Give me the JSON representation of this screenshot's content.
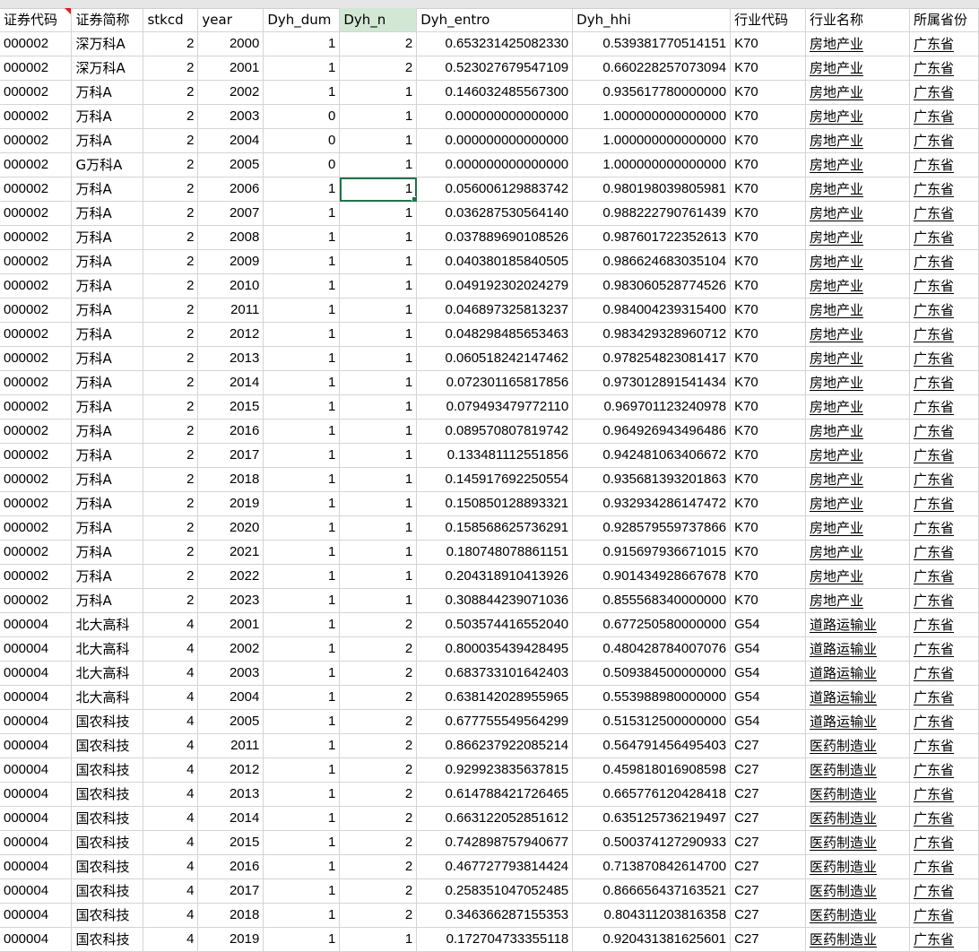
{
  "columns": [
    "证券代码",
    "证券简称",
    "stkcd",
    "year",
    "Dyh_dum",
    "Dyh_n",
    "Dyh_entro",
    "Dyh_hhi",
    "行业代码",
    "行业名称",
    "所属省份"
  ],
  "header_display": [
    "证券代码",
    "证券简称",
    "stkcd",
    "year",
    "Dyh_dum",
    "Dyh_n",
    "Dyh_entro",
    "Dyh_hhi",
    "行业代码",
    "行业名称",
    "所属省份"
  ],
  "rows": [
    [
      "000002",
      "深万科A",
      "2",
      "2000",
      "1",
      "2",
      "0.653231425082330",
      "0.539381770514151",
      "K70",
      "房地产业",
      "广东省"
    ],
    [
      "000002",
      "深万科A",
      "2",
      "2001",
      "1",
      "2",
      "0.523027679547109",
      "0.660228257073094",
      "K70",
      "房地产业",
      "广东省"
    ],
    [
      "000002",
      "万科A",
      "2",
      "2002",
      "1",
      "1",
      "0.146032485567300",
      "0.935617780000000",
      "K70",
      "房地产业",
      "广东省"
    ],
    [
      "000002",
      "万科A",
      "2",
      "2003",
      "0",
      "1",
      "0.000000000000000",
      "1.000000000000000",
      "K70",
      "房地产业",
      "广东省"
    ],
    [
      "000002",
      "万科A",
      "2",
      "2004",
      "0",
      "1",
      "0.000000000000000",
      "1.000000000000000",
      "K70",
      "房地产业",
      "广东省"
    ],
    [
      "000002",
      "G万科A",
      "2",
      "2005",
      "0",
      "1",
      "0.000000000000000",
      "1.000000000000000",
      "K70",
      "房地产业",
      "广东省"
    ],
    [
      "000002",
      "万科A",
      "2",
      "2006",
      "1",
      "1",
      "0.056006129883742",
      "0.980198039805981",
      "K70",
      "房地产业",
      "广东省"
    ],
    [
      "000002",
      "万科A",
      "2",
      "2007",
      "1",
      "1",
      "0.036287530564140",
      "0.988222790761439",
      "K70",
      "房地产业",
      "广东省"
    ],
    [
      "000002",
      "万科A",
      "2",
      "2008",
      "1",
      "1",
      "0.037889690108526",
      "0.987601722352613",
      "K70",
      "房地产业",
      "广东省"
    ],
    [
      "000002",
      "万科A",
      "2",
      "2009",
      "1",
      "1",
      "0.040380185840505",
      "0.986624683035104",
      "K70",
      "房地产业",
      "广东省"
    ],
    [
      "000002",
      "万科A",
      "2",
      "2010",
      "1",
      "1",
      "0.049192302024279",
      "0.983060528774526",
      "K70",
      "房地产业",
      "广东省"
    ],
    [
      "000002",
      "万科A",
      "2",
      "2011",
      "1",
      "1",
      "0.046897325813237",
      "0.984004239315400",
      "K70",
      "房地产业",
      "广东省"
    ],
    [
      "000002",
      "万科A",
      "2",
      "2012",
      "1",
      "1",
      "0.048298485653463",
      "0.983429328960712",
      "K70",
      "房地产业",
      "广东省"
    ],
    [
      "000002",
      "万科A",
      "2",
      "2013",
      "1",
      "1",
      "0.060518242147462",
      "0.978254823081417",
      "K70",
      "房地产业",
      "广东省"
    ],
    [
      "000002",
      "万科A",
      "2",
      "2014",
      "1",
      "1",
      "0.072301165817856",
      "0.973012891541434",
      "K70",
      "房地产业",
      "广东省"
    ],
    [
      "000002",
      "万科A",
      "2",
      "2015",
      "1",
      "1",
      "0.079493479772110",
      "0.969701123240978",
      "K70",
      "房地产业",
      "广东省"
    ],
    [
      "000002",
      "万科A",
      "2",
      "2016",
      "1",
      "1",
      "0.089570807819742",
      "0.964926943496486",
      "K70",
      "房地产业",
      "广东省"
    ],
    [
      "000002",
      "万科A",
      "2",
      "2017",
      "1",
      "1",
      "0.133481112551856",
      "0.942481063406672",
      "K70",
      "房地产业",
      "广东省"
    ],
    [
      "000002",
      "万科A",
      "2",
      "2018",
      "1",
      "1",
      "0.145917692250554",
      "0.935681393201863",
      "K70",
      "房地产业",
      "广东省"
    ],
    [
      "000002",
      "万科A",
      "2",
      "2019",
      "1",
      "1",
      "0.150850128893321",
      "0.932934286147472",
      "K70",
      "房地产业",
      "广东省"
    ],
    [
      "000002",
      "万科A",
      "2",
      "2020",
      "1",
      "1",
      "0.158568625736291",
      "0.928579559737866",
      "K70",
      "房地产业",
      "广东省"
    ],
    [
      "000002",
      "万科A",
      "2",
      "2021",
      "1",
      "1",
      "0.180748078861151",
      "0.915697936671015",
      "K70",
      "房地产业",
      "广东省"
    ],
    [
      "000002",
      "万科A",
      "2",
      "2022",
      "1",
      "1",
      "0.204318910413926",
      "0.901434928667678",
      "K70",
      "房地产业",
      "广东省"
    ],
    [
      "000002",
      "万科A",
      "2",
      "2023",
      "1",
      "1",
      "0.308844239071036",
      "0.855568340000000",
      "K70",
      "房地产业",
      "广东省"
    ],
    [
      "000004",
      "北大高科",
      "4",
      "2001",
      "1",
      "2",
      "0.503574416552040",
      "0.677250580000000",
      "G54",
      "道路运输业",
      "广东省"
    ],
    [
      "000004",
      "北大高科",
      "4",
      "2002",
      "1",
      "2",
      "0.800035439428495",
      "0.480428784007076",
      "G54",
      "道路运输业",
      "广东省"
    ],
    [
      "000004",
      "北大高科",
      "4",
      "2003",
      "1",
      "2",
      "0.683733101642403",
      "0.509384500000000",
      "G54",
      "道路运输业",
      "广东省"
    ],
    [
      "000004",
      "北大高科",
      "4",
      "2004",
      "1",
      "2",
      "0.638142028955965",
      "0.553988980000000",
      "G54",
      "道路运输业",
      "广东省"
    ],
    [
      "000004",
      "国农科技",
      "4",
      "2005",
      "1",
      "2",
      "0.677755549564299",
      "0.515312500000000",
      "G54",
      "道路运输业",
      "广东省"
    ],
    [
      "000004",
      "国农科技",
      "4",
      "2011",
      "1",
      "2",
      "0.866237922085214",
      "0.564791456495403",
      "C27",
      "医药制造业",
      "广东省"
    ],
    [
      "000004",
      "国农科技",
      "4",
      "2012",
      "1",
      "2",
      "0.929923835637815",
      "0.459818016908598",
      "C27",
      "医药制造业",
      "广东省"
    ],
    [
      "000004",
      "国农科技",
      "4",
      "2013",
      "1",
      "2",
      "0.614788421726465",
      "0.665776120428418",
      "C27",
      "医药制造业",
      "广东省"
    ],
    [
      "000004",
      "国农科技",
      "4",
      "2014",
      "1",
      "2",
      "0.663122052851612",
      "0.635125736219497",
      "C27",
      "医药制造业",
      "广东省"
    ],
    [
      "000004",
      "国农科技",
      "4",
      "2015",
      "1",
      "2",
      "0.742898757940677",
      "0.500374127290933",
      "C27",
      "医药制造业",
      "广东省"
    ],
    [
      "000004",
      "国农科技",
      "4",
      "2016",
      "1",
      "2",
      "0.467727793814424",
      "0.713870842614700",
      "C27",
      "医药制造业",
      "广东省"
    ],
    [
      "000004",
      "国农科技",
      "4",
      "2017",
      "1",
      "2",
      "0.258351047052485",
      "0.866656437163521",
      "C27",
      "医药制造业",
      "广东省"
    ],
    [
      "000004",
      "国农科技",
      "4",
      "2018",
      "1",
      "2",
      "0.346366287155353",
      "0.804311203816358",
      "C27",
      "医药制造业",
      "广东省"
    ],
    [
      "000004",
      "国农科技",
      "4",
      "2019",
      "1",
      "1",
      "0.172704733355118",
      "0.920431381625601",
      "C27",
      "医药制造业",
      "广东省"
    ]
  ],
  "selected_cell": {
    "row": 6,
    "col": 5
  },
  "colors": {
    "grid_line": "#d4d4d4",
    "selection": "#217346",
    "highlight_header": "#d3e7d5",
    "comment_marker": "#e02020"
  }
}
